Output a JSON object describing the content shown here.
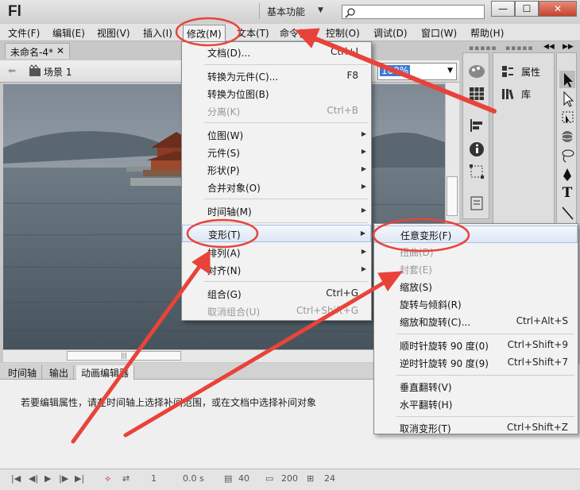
{
  "app": {
    "logo": "Fl",
    "workspace": "基本功能",
    "search_placeholder": "",
    "win_min": "—",
    "win_max": "☐",
    "win_close": "✕"
  },
  "menubar": {
    "items": [
      "文件(F)",
      "编辑(E)",
      "视图(V)",
      "插入(I)",
      "修改(M)",
      "文本(T)",
      "命令(C)",
      "控制(O)",
      "调试(D)",
      "窗口(W)",
      "帮助(H)"
    ]
  },
  "document": {
    "tab_label": "未命名-4*",
    "tab_close": "✕",
    "scene_label": "场景 1",
    "zoom": "100%"
  },
  "modify_menu": {
    "items": [
      {
        "label": "文档(D)...",
        "shortcut": "Ctrl+J",
        "submenu": false,
        "disabled": false
      },
      {
        "label": "转换为元件(C)...",
        "shortcut": "F8",
        "submenu": false,
        "disabled": false
      },
      {
        "label": "转换为位图(B)",
        "shortcut": "",
        "submenu": false,
        "disabled": false
      },
      {
        "label": "分离(K)",
        "shortcut": "Ctrl+B",
        "submenu": false,
        "disabled": true
      },
      {
        "label": "位图(W)",
        "shortcut": "",
        "submenu": true,
        "disabled": false
      },
      {
        "label": "元件(S)",
        "shortcut": "",
        "submenu": true,
        "disabled": false
      },
      {
        "label": "形状(P)",
        "shortcut": "",
        "submenu": true,
        "disabled": false
      },
      {
        "label": "合并对象(O)",
        "shortcut": "",
        "submenu": true,
        "disabled": false
      },
      {
        "label": "时间轴(M)",
        "shortcut": "",
        "submenu": true,
        "disabled": false
      },
      {
        "label": "变形(T)",
        "shortcut": "",
        "submenu": true,
        "disabled": false
      },
      {
        "label": "排列(A)",
        "shortcut": "",
        "submenu": true,
        "disabled": false
      },
      {
        "label": "对齐(N)",
        "shortcut": "",
        "submenu": true,
        "disabled": false
      },
      {
        "label": "组合(G)",
        "shortcut": "Ctrl+G",
        "submenu": false,
        "disabled": false
      },
      {
        "label": "取消组合(U)",
        "shortcut": "Ctrl+Shift+G",
        "submenu": false,
        "disabled": true
      }
    ]
  },
  "transform_menu": {
    "items": [
      {
        "label": "任意变形(F)",
        "shortcut": "",
        "disabled": false
      },
      {
        "label": "扭曲(D)",
        "shortcut": "",
        "disabled": true
      },
      {
        "label": "封套(E)",
        "shortcut": "",
        "disabled": true
      },
      {
        "label": "缩放(S)",
        "shortcut": "",
        "disabled": false
      },
      {
        "label": "旋转与倾斜(R)",
        "shortcut": "",
        "disabled": false
      },
      {
        "label": "缩放和旋转(C)...",
        "shortcut": "Ctrl+Alt+S",
        "disabled": false
      },
      {
        "label": "顺时针旋转 90 度(0)",
        "shortcut": "Ctrl+Shift+9",
        "disabled": false
      },
      {
        "label": "逆时针旋转 90 度(9)",
        "shortcut": "Ctrl+Shift+7",
        "disabled": false
      },
      {
        "label": "垂直翻转(V)",
        "shortcut": "",
        "disabled": false
      },
      {
        "label": "水平翻转(H)",
        "shortcut": "",
        "disabled": false
      },
      {
        "label": "取消变形(T)",
        "shortcut": "Ctrl+Shift+Z",
        "disabled": false
      }
    ]
  },
  "right_panel": {
    "properties": "属性",
    "library": "库"
  },
  "bottom": {
    "tabs": [
      "时间轴",
      "输出",
      "动画编辑器"
    ],
    "hint": "若要编辑属性，请在时间轴上选择补间范围，或在文档中选择补间对象"
  },
  "controls": {
    "frame": "1",
    "time": "0.0 s",
    "v1": "40",
    "v2": "200",
    "v3": "24"
  },
  "colors": {
    "highlight": "#dce7f6",
    "annotation": "#e8433a"
  }
}
